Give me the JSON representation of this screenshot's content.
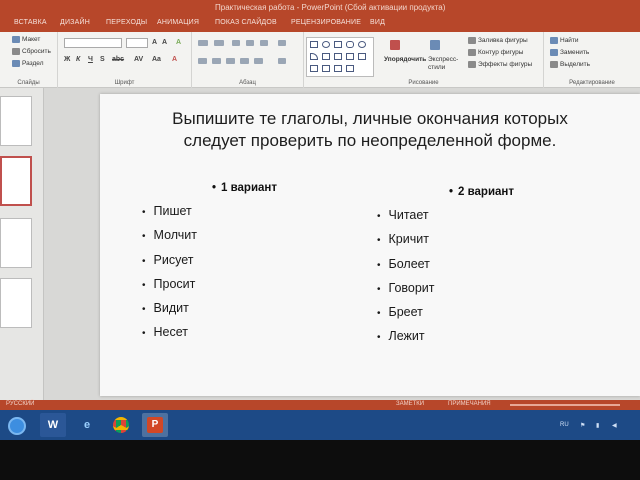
{
  "window": {
    "title": "Практическая работа - PowerPoint (Сбой активации продукта)"
  },
  "tabs": [
    "ВСТАВКА",
    "ДИЗАЙН",
    "ПЕРЕХОДЫ",
    "АНИМАЦИЯ",
    "ПОКАЗ СЛАЙДОВ",
    "РЕЦЕНЗИРОВАНИЕ",
    "ВИД"
  ],
  "ribbon": {
    "slides_group": {
      "label": "Слайды",
      "layout": "Макет",
      "reset": "Сбросить",
      "section": "Раздел"
    },
    "font_group": {
      "label": "Шрифт"
    },
    "paragraph_group": {
      "label": "Абзац"
    },
    "drawing_group": {
      "label": "Рисование",
      "arrange": "Упорядочить",
      "quick_styles": "Экспресс-стили",
      "fill": "Заливка фигуры",
      "outline": "Контур фигуры",
      "effects": "Эффекты фигуры"
    },
    "editing_group": {
      "label": "Редактирование",
      "find": "Найти",
      "replace": "Заменить",
      "select": "Выделить"
    }
  },
  "slide": {
    "title_line1": "Выпишите те глаголы, личные окончания которых",
    "title_line2": "следует проверить по неопределенной форме.",
    "variant1": {
      "heading": "1 вариант",
      "items": [
        "Пишет",
        "Молчит",
        "Рисует",
        "Просит",
        "Видит",
        "Несет"
      ]
    },
    "variant2": {
      "heading": "2 вариант",
      "items": [
        "Читает",
        "Кричит",
        "Болеет",
        "Говорит",
        "Бреет",
        "Лежит"
      ]
    }
  },
  "status": {
    "language": "РУССКИЙ",
    "notes": "ЗАМЕТКИ",
    "comments": "ПРИМЕЧАНИЯ"
  },
  "taskbar": {
    "keyboard_layout": "RU"
  },
  "colors": {
    "brand": "#b7472a",
    "taskbar": "#1d4a86"
  }
}
